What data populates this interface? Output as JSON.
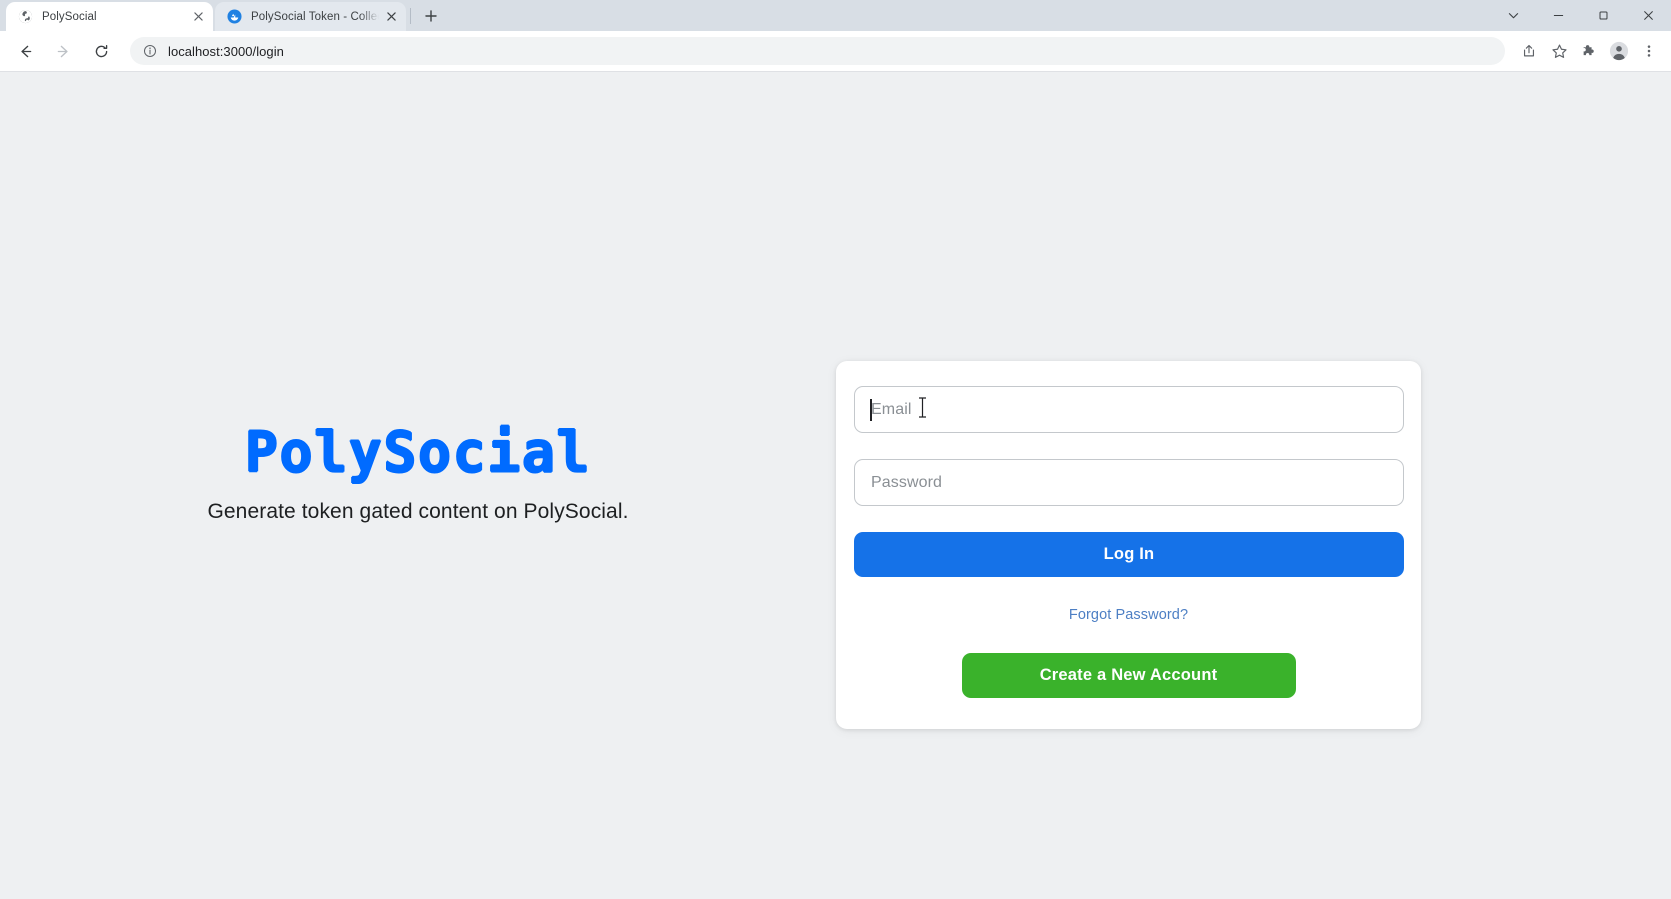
{
  "browser": {
    "tabs": [
      {
        "title": "PolySocial",
        "favicon": "globe-icon",
        "active": true
      },
      {
        "title": "PolySocial Token - Collection | Op",
        "favicon": "opensea-icon",
        "active": false
      }
    ],
    "new_tab_label": "+",
    "window_controls": {
      "tab_search": "tab-search-icon",
      "minimize": "minimize-icon",
      "maximize": "maximize-icon",
      "close": "close-icon"
    },
    "nav": {
      "back": "back-arrow-icon",
      "forward": "forward-arrow-icon",
      "reload": "reload-icon"
    },
    "omnibox": {
      "site_info": "info-circle-icon",
      "url": "localhost:3000/login"
    },
    "toolbar_icons": {
      "share": "share-icon",
      "bookmark": "star-icon",
      "extensions": "puzzle-piece-icon",
      "profile": "profile-avatar-icon",
      "menu": "three-dot-menu-icon"
    }
  },
  "page": {
    "brand": "PolySocial",
    "tagline": "Generate token gated content on PolySocial.",
    "login": {
      "email_placeholder": "Email",
      "password_placeholder": "Password",
      "email_value": "",
      "password_value": "",
      "login_button": "Log In",
      "forgot_link": "Forgot Password?",
      "create_account_button": "Create a New Account"
    }
  },
  "colors": {
    "brand_blue": "#1f6fe5",
    "primary_button": "#1572e8",
    "success_button": "#3ab22b",
    "link_blue": "#4d7fc4",
    "page_background": "#eef0f2",
    "card_background": "#ffffff",
    "tabstrip_background": "#d8dee5"
  }
}
